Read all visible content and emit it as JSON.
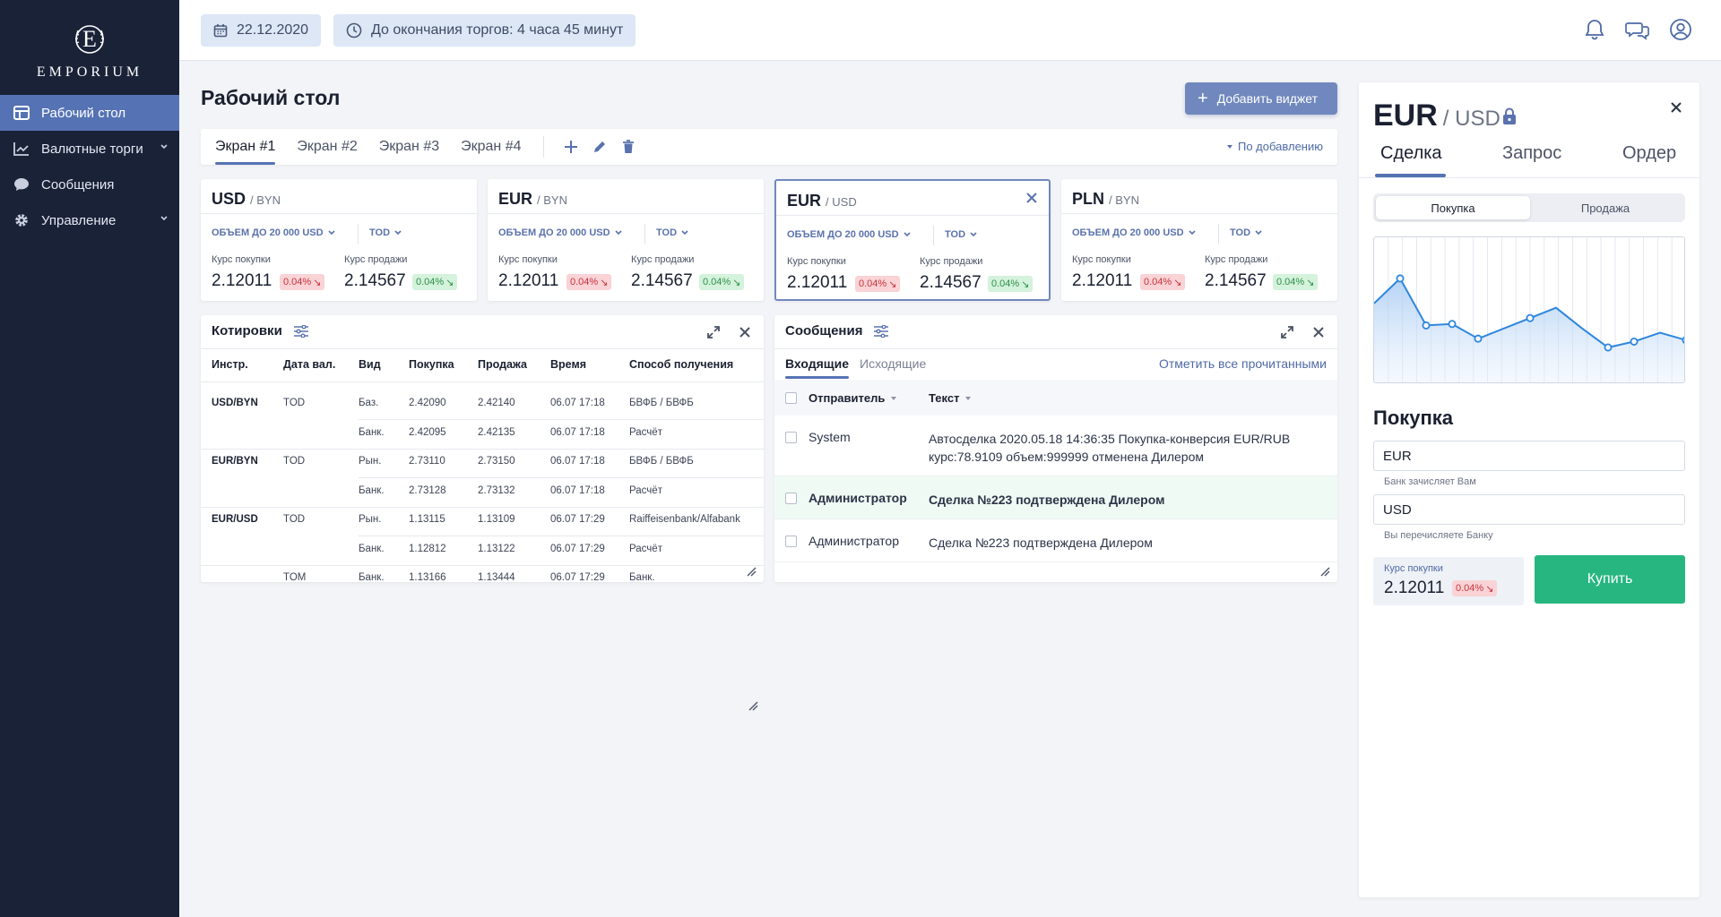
{
  "brand": {
    "name": "EMPORIUM",
    "letter": "E"
  },
  "sidebar": {
    "items": [
      {
        "label": "Рабочий стол",
        "icon": "dashboard-icon"
      },
      {
        "label": "Валютные торги",
        "icon": "chart-icon"
      },
      {
        "label": "Сообщения",
        "icon": "chat-icon"
      },
      {
        "label": "Управление",
        "icon": "gear-icon"
      }
    ]
  },
  "header": {
    "date": "22.12.2020",
    "countdown": "До окончания торгов: 4 часа 45 минут",
    "icons": [
      "bell-icon",
      "chat-icon",
      "user-icon"
    ]
  },
  "page": {
    "title": "Рабочий стол",
    "add_widget": "Добавить виджет",
    "sort_label": "По добавлению",
    "tabs": [
      "Экран #1",
      "Экран #2",
      "Экран #3",
      "Экран #4"
    ]
  },
  "cards": [
    {
      "base": "USD",
      "quote": "/ BYN",
      "volume": "ОБЪЕМ ДО 20 000 USD",
      "term": "TOD",
      "buy_label": "Курс покупки",
      "sell_label": "Курс продажи",
      "buy": "2.12011",
      "buy_change": "0.04%",
      "sell": "2.14567",
      "sell_change": "0.04%"
    },
    {
      "base": "EUR",
      "quote": "/ BYN",
      "volume": "ОБЪЕМ ДО 20 000 USD",
      "term": "TOD",
      "buy_label": "Курс покупки",
      "sell_label": "Курс продажи",
      "buy": "2.12011",
      "buy_change": "0.04%",
      "sell": "2.14567",
      "sell_change": "0.04%"
    },
    {
      "base": "EUR",
      "quote": "/ USD",
      "volume": "ОБЪЕМ ДО 20 000 USD",
      "term": "TOD",
      "buy_label": "Курс покупки",
      "sell_label": "Курс продажи",
      "buy": "2.12011",
      "buy_change": "0.04%",
      "sell": "2.14567",
      "sell_change": "0.04%"
    },
    {
      "base": "PLN",
      "quote": "/ BYN",
      "volume": "ОБЪЕМ ДО 20 000 USD",
      "term": "TOD",
      "buy_label": "Курс покупки",
      "sell_label": "Курс продажи",
      "buy": "2.12011",
      "buy_change": "0.04%",
      "sell": "2.14567",
      "sell_change": "0.04%"
    }
  ],
  "quotes": {
    "title": "Котировки",
    "columns": [
      "Инстр.",
      "Дата вал.",
      "Вид",
      "Покупка",
      "Продажа",
      "Время",
      "Способ получения"
    ],
    "rows": [
      {
        "instr": "USD/BYN",
        "date": "TOD",
        "kind": "Баз.",
        "buy": "2.42090",
        "sell": "2.42140",
        "time": "06.07 17:18",
        "method": "БВФБ / БВФБ"
      },
      {
        "instr": "",
        "date": "",
        "kind": "Банк.",
        "buy": "2.42095",
        "sell": "2.42135",
        "time": "06.07 17:18",
        "method": "Расчёт"
      },
      {
        "instr": "EUR/BYN",
        "date": "TOD",
        "kind": "Рын.",
        "buy": "2.73110",
        "sell": "2.73150",
        "time": "06.07 17:18",
        "method": "БВФБ / БВФБ"
      },
      {
        "instr": "",
        "date": "",
        "kind": "Банк.",
        "buy": "2.73128",
        "sell": "2.73132",
        "time": "06.07 17:18",
        "method": "Расчёт"
      },
      {
        "instr": "EUR/USD",
        "date": "TOD",
        "kind": "Рын.",
        "buy": "1.13115",
        "sell": "1.13109",
        "time": "06.07 17:29",
        "method": "Raiffeisenbank/Alfabank"
      },
      {
        "instr": "",
        "date": "",
        "kind": "Банк.",
        "buy": "1.12812",
        "sell": "1.13122",
        "time": "06.07 17:29",
        "method": "Расчёт"
      },
      {
        "instr": "",
        "date": "TOM",
        "kind": "Банк.",
        "buy": "1.13166",
        "sell": "1.13444",
        "time": "06.07 17:29",
        "method": "Банк."
      }
    ]
  },
  "messages": {
    "title": "Сообщения",
    "tabs": [
      "Входящие",
      "Исходящие"
    ],
    "mark_all": "Отметить все прочитанными",
    "col_sender": "Отправитель",
    "col_text": "Текст",
    "rows": [
      {
        "sender": "System",
        "text": "Автосделка 2020.05.18 14:36:35 Покупка-конверсия EUR/RUB курс:78.9109 объем:999999 отменена Дилером",
        "unread": false
      },
      {
        "sender": "Администратор",
        "text": "Сделка №223 подтверждена Дилером",
        "unread": true
      },
      {
        "sender": "Администратор",
        "text": "Сделка №223 подтверждена Дилером",
        "unread": false
      }
    ]
  },
  "trade": {
    "base": "EUR",
    "quote": "/ USD",
    "tabs": [
      "Сделка",
      "Запрос",
      "Ордер"
    ],
    "modes": [
      "Покупка",
      "Продажа"
    ],
    "heading": "Покупка",
    "field1": "EUR",
    "hint1": "Банк зачисляет Вам",
    "field2": "USD",
    "hint2": "Вы перечисляете Банку",
    "rate_label": "Курс покупки",
    "rate": "2.12011",
    "rate_change": "0.04%",
    "buy_button": "Купить",
    "accent": "#27b680"
  },
  "chart_data": {
    "type": "line",
    "values": [
      0.55,
      0.72,
      0.4,
      0.41,
      0.31,
      0.38,
      0.45,
      0.52,
      0.38,
      0.25,
      0.29,
      0.35,
      0.3
    ],
    "markers": [
      1,
      2,
      3,
      4,
      6,
      9,
      10,
      12
    ],
    "ylim": [
      0,
      1
    ],
    "grid": true,
    "color": "#2e86de"
  }
}
